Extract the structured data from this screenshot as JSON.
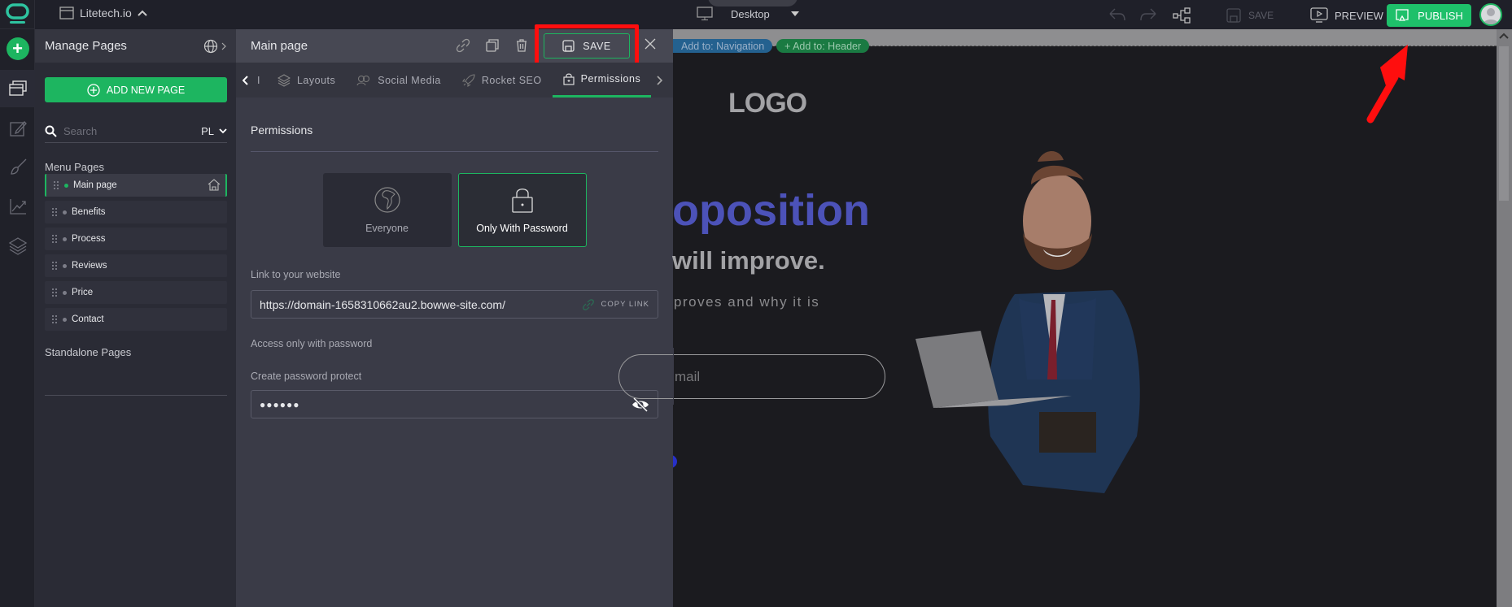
{
  "topbar": {
    "site_name": "Litetech.io",
    "device": "Desktop",
    "save_label": "SAVE",
    "preview_label": "PREVIEW",
    "publish_label": "PUBLISH"
  },
  "sidebar": {
    "title": "Manage Pages",
    "add_page_label": "ADD NEW PAGE",
    "search_placeholder": "Search",
    "language": "PL",
    "menu_pages_title": "Menu Pages",
    "pages": [
      {
        "label": "Main page",
        "active": true,
        "home": true
      },
      {
        "label": "Benefits"
      },
      {
        "label": "Process"
      },
      {
        "label": "Reviews"
      },
      {
        "label": "Price"
      },
      {
        "label": "Contact"
      }
    ],
    "standalone_title": "Standalone Pages"
  },
  "panel": {
    "title": "Main page",
    "save_label": "SAVE",
    "tabs": [
      {
        "label": "I"
      },
      {
        "label": "Layouts"
      },
      {
        "label": "Social Media"
      },
      {
        "label": "Rocket SEO"
      },
      {
        "label": "Permissions",
        "active": true
      }
    ],
    "section_title": "Permissions",
    "options": [
      {
        "label": "Everyone",
        "icon": "globe-icon"
      },
      {
        "label": "Only With Password",
        "icon": "lock-icon",
        "selected": true
      }
    ],
    "link_label": "Link to your website",
    "link_value": "https://domain-1658310662au2.bowwe-site.com/",
    "copy_link_label": "COPY LINK",
    "access_note": "Access only with password",
    "password_label": "Create password protect",
    "password_value": "●●●●●●"
  },
  "canvas": {
    "chip_navigation": "Add to: Navigation",
    "chip_header": "+ Add to: Header",
    "logo": "LOGO",
    "headline": "oposition",
    "subheadline": "will improve.",
    "description": "proves and why it is",
    "email_placeholder": "mail"
  },
  "colors": {
    "accent": "#1db560",
    "highlight": "#ff0e0e",
    "headline": "#4c52b8"
  }
}
